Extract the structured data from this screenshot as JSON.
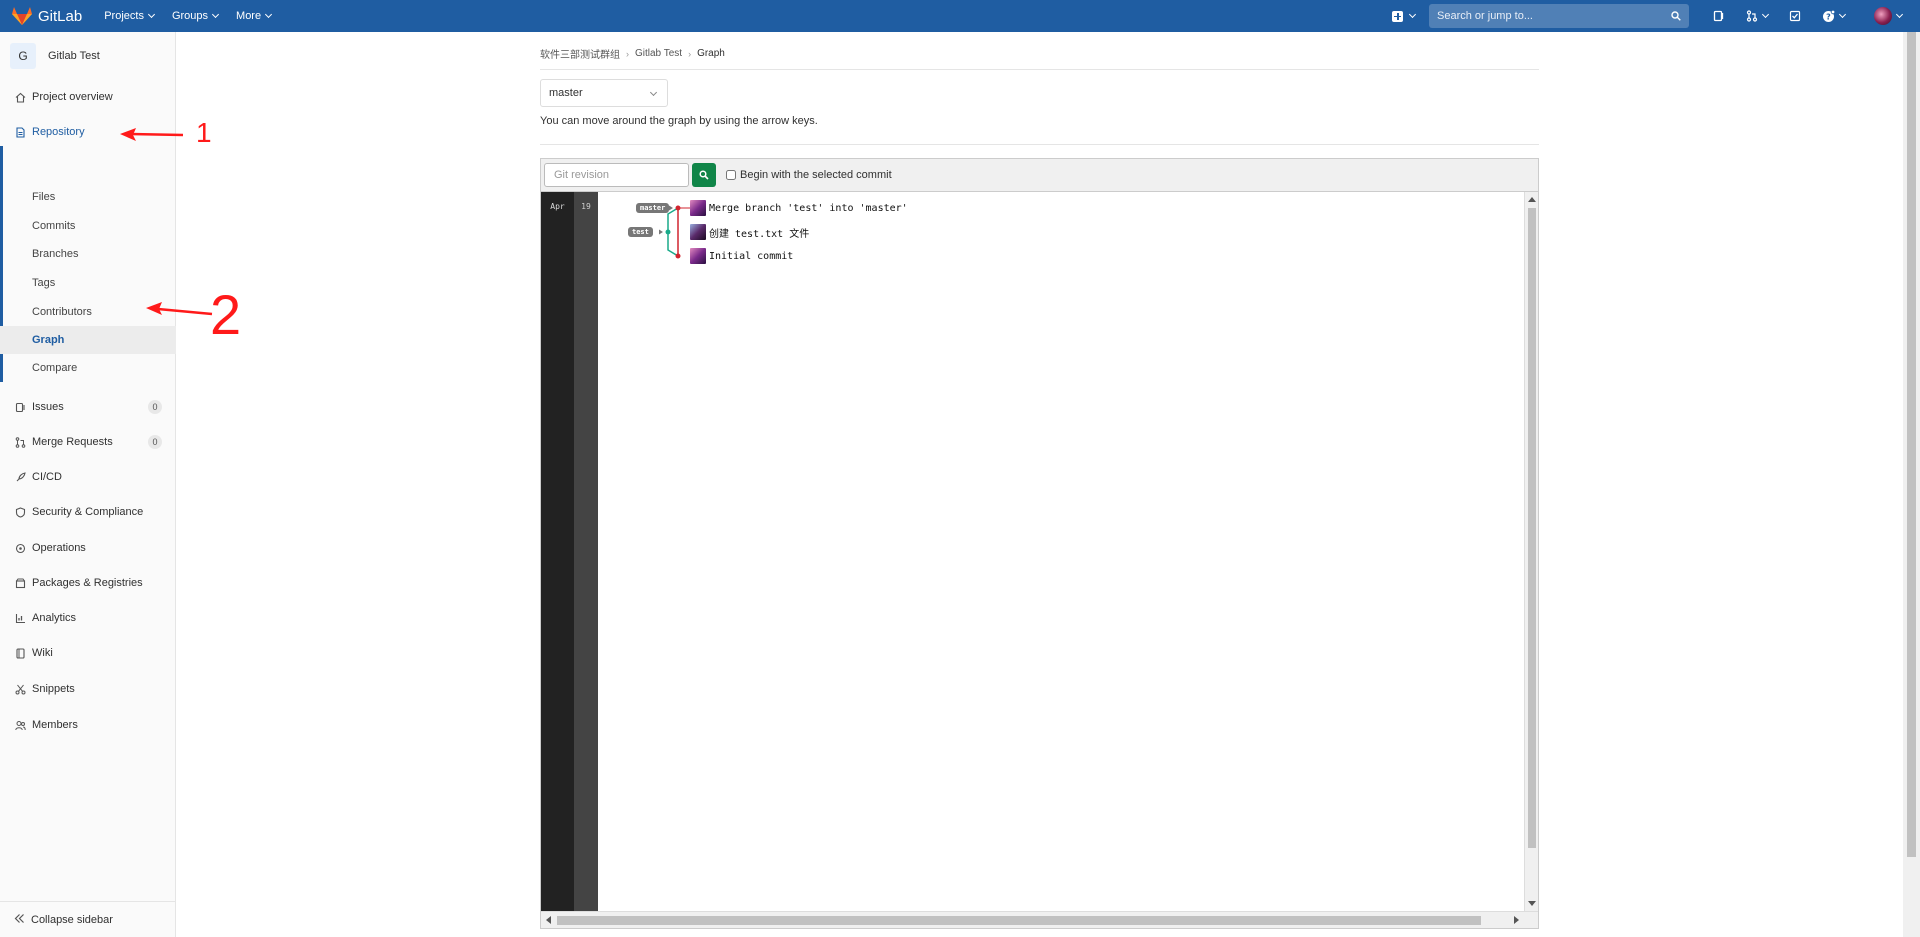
{
  "header": {
    "logo_text": "GitLab",
    "nav": [
      "Projects",
      "Groups",
      "More"
    ],
    "search_placeholder": "Search or jump to..."
  },
  "sidebar": {
    "project_initial": "G",
    "project_name": "Gitlab Test",
    "items": {
      "project_overview": "Project overview",
      "repository": "Repository",
      "files": "Files",
      "commits": "Commits",
      "branches": "Branches",
      "tags": "Tags",
      "contributors": "Contributors",
      "graph": "Graph",
      "compare": "Compare",
      "issues": "Issues",
      "issues_count": "0",
      "merge_requests": "Merge Requests",
      "merge_requests_count": "0",
      "cicd": "CI/CD",
      "security": "Security & Compliance",
      "operations": "Operations",
      "packages": "Packages & Registries",
      "analytics": "Analytics",
      "wiki": "Wiki",
      "snippets": "Snippets",
      "members": "Members"
    },
    "collapse_label": "Collapse sidebar"
  },
  "breadcrumb": {
    "group": "软件三部测试群组",
    "project": "Gitlab Test",
    "current": "Graph"
  },
  "branch_select": {
    "value": "master"
  },
  "hint": "You can move around the graph by using the arrow keys.",
  "graph": {
    "revision_placeholder": "Git revision",
    "begin_label": "Begin with the selected commit",
    "month": "Apr",
    "day": "19",
    "refs": {
      "master": "master",
      "test": "test"
    },
    "commits": [
      "Merge branch 'test' into 'master'",
      "创建 test.txt 文件",
      "Initial commit"
    ]
  },
  "annotations": [
    "1",
    "2"
  ],
  "colors": {
    "navbar": "#1f5da2",
    "accent": "#1f5da2",
    "success": "#108548",
    "branch_red": "#d1242f",
    "branch_teal": "#1aaa8a",
    "annotation": "#ff1a1a"
  }
}
